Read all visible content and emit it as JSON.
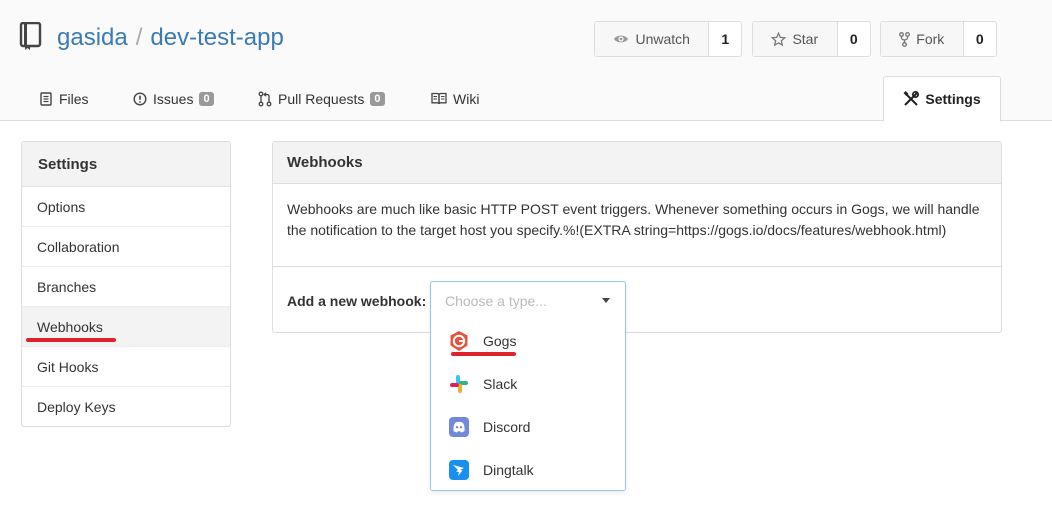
{
  "repo": {
    "owner": "gasida",
    "name": "dev-test-app"
  },
  "header_buttons": {
    "watch": {
      "label": "Unwatch",
      "count": "1"
    },
    "star": {
      "label": "Star",
      "count": "0"
    },
    "fork": {
      "label": "Fork",
      "count": "0"
    }
  },
  "tabs": {
    "files": {
      "label": "Files"
    },
    "issues": {
      "label": "Issues",
      "badge": "0"
    },
    "pulls": {
      "label": "Pull Requests",
      "badge": "0"
    },
    "wiki": {
      "label": "Wiki"
    },
    "settings": {
      "label": "Settings"
    }
  },
  "sidebar": {
    "title": "Settings",
    "items": [
      {
        "label": "Options"
      },
      {
        "label": "Collaboration"
      },
      {
        "label": "Branches"
      },
      {
        "label": "Webhooks"
      },
      {
        "label": "Git Hooks"
      },
      {
        "label": "Deploy Keys"
      }
    ]
  },
  "panel": {
    "title": "Webhooks",
    "description": "Webhooks are much like basic HTTP POST event triggers. Whenever something occurs in Gogs, we will handle the notification to the target host you specify.%!(EXTRA string=https://gogs.io/docs/features/webhook.html)",
    "add_label": "Add a new webhook:"
  },
  "dropdown": {
    "placeholder": "Choose a type...",
    "options": [
      {
        "label": "Gogs",
        "icon": "gogs-icon"
      },
      {
        "label": "Slack",
        "icon": "slack-icon"
      },
      {
        "label": "Discord",
        "icon": "discord-icon"
      },
      {
        "label": "Dingtalk",
        "icon": "dingtalk-icon"
      }
    ]
  },
  "colors": {
    "link": "#3a7bb5",
    "highlight": "#e0222b",
    "dropdown_border": "#96c8da"
  }
}
